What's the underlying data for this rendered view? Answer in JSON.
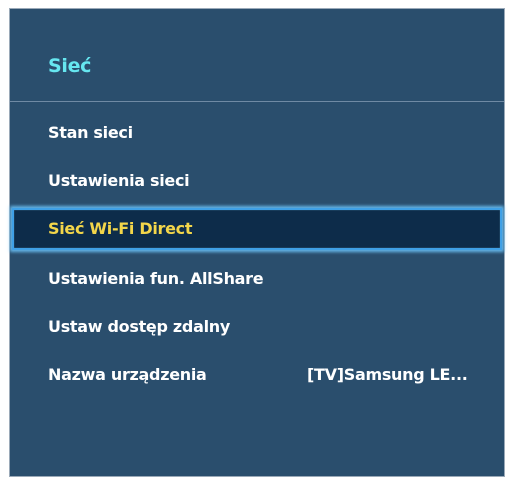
{
  "menu": {
    "title": "Sieć",
    "items": [
      {
        "label": "Stan sieci",
        "value": ""
      },
      {
        "label": "Ustawienia sieci",
        "value": ""
      },
      {
        "label": "Sieć Wi-Fi Direct",
        "value": "",
        "selected": true
      },
      {
        "label": "Ustawienia fun. AllShare",
        "value": ""
      },
      {
        "label": "Ustaw dostęp zdalny",
        "value": ""
      },
      {
        "label": "Nazwa urządzenia",
        "value": "[TV]Samsung LE..."
      }
    ]
  },
  "colors": {
    "panel_bg": "#2a4e6d",
    "title": "#66e7f0",
    "selected_text": "#f3d64a",
    "selected_bg": "#0d2c4a",
    "highlight_border": "#3fa0e6"
  }
}
